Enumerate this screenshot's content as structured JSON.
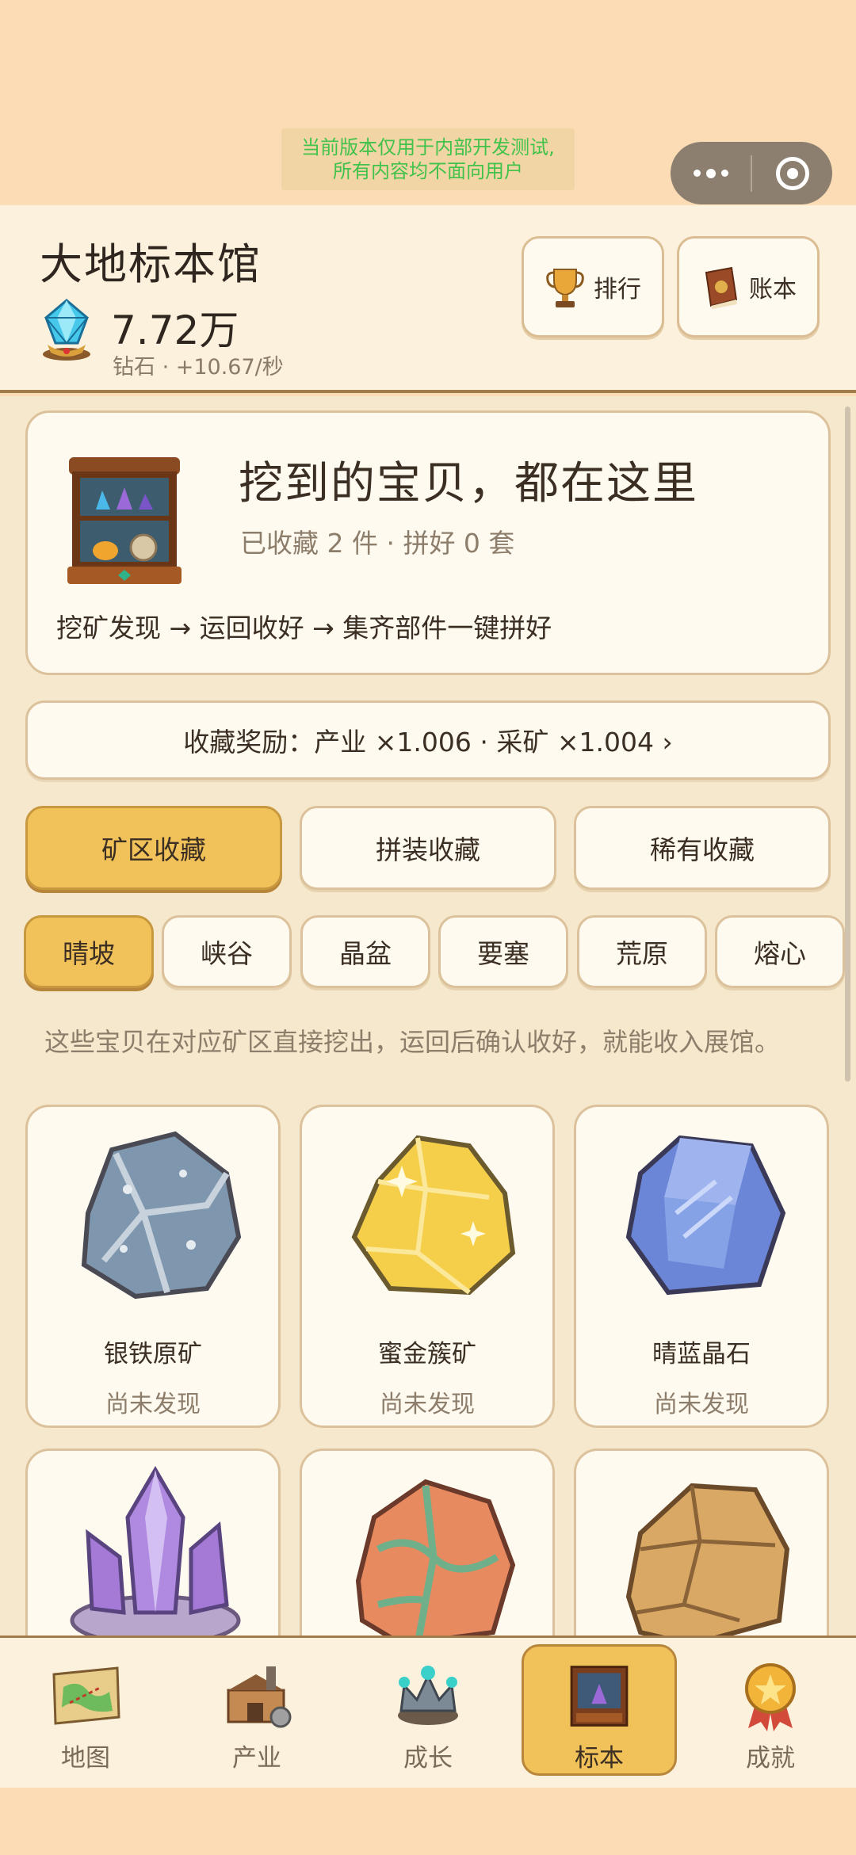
{
  "system": {
    "dev_notice_line1": "当前版本仅用于内部开发测试,",
    "dev_notice_line2": "所有内容均不面向用户"
  },
  "header": {
    "title": "大地标本馆",
    "diamond_amount": "7.72万",
    "diamond_rate": "钻石 · +10.67/秒",
    "rank_label": "排行",
    "ledger_label": "账本"
  },
  "intro": {
    "headline": "挖到的宝贝，都在这里",
    "stats": "已收藏 2 件 · 拼好 0 套",
    "flow": "挖矿发现 → 运回收好 → 集齐部件一键拼好"
  },
  "bonus": {
    "label": "收藏奖励：产业 ×1.006 · 采矿 ×1.004 ›"
  },
  "main_tabs": [
    {
      "label": "矿区收藏",
      "active": true
    },
    {
      "label": "拼装收藏",
      "active": false
    },
    {
      "label": "稀有收藏",
      "active": false
    }
  ],
  "sub_tabs": [
    {
      "label": "晴坡",
      "active": true
    },
    {
      "label": "峡谷",
      "active": false
    },
    {
      "label": "晶盆",
      "active": false
    },
    {
      "label": "要塞",
      "active": false
    },
    {
      "label": "荒原",
      "active": false
    },
    {
      "label": "熔心",
      "active": false
    }
  ],
  "hint": "这些宝贝在对应矿区直接挖出，运回后确认收好，就能收入展馆。",
  "items": [
    {
      "name": "银铁原矿",
      "status": "尚未发现",
      "icon": "silver-iron-ore-icon"
    },
    {
      "name": "蜜金簇矿",
      "status": "尚未发现",
      "icon": "honey-gold-ore-icon"
    },
    {
      "name": "晴蓝晶石",
      "status": "尚未发现",
      "icon": "blue-crystal-icon"
    },
    {
      "name": "",
      "status": "",
      "icon": "purple-crystal-cluster-icon"
    },
    {
      "name": "",
      "status": "",
      "icon": "copper-ore-icon"
    },
    {
      "name": "",
      "status": "",
      "icon": "sandstone-ore-icon"
    }
  ],
  "nav": [
    {
      "label": "地图",
      "icon": "map-icon",
      "active": false
    },
    {
      "label": "产业",
      "icon": "factory-icon",
      "active": false
    },
    {
      "label": "成长",
      "icon": "crown-icon",
      "active": false
    },
    {
      "label": "标本",
      "icon": "display-cabinet-icon",
      "active": true
    },
    {
      "label": "成就",
      "icon": "medal-icon",
      "active": false
    }
  ],
  "colors": {
    "accent": "#f2c25a",
    "background": "#f5e8cd",
    "card": "#fffaef",
    "border": "#dcc29c",
    "notice_text": "#41c24b"
  }
}
